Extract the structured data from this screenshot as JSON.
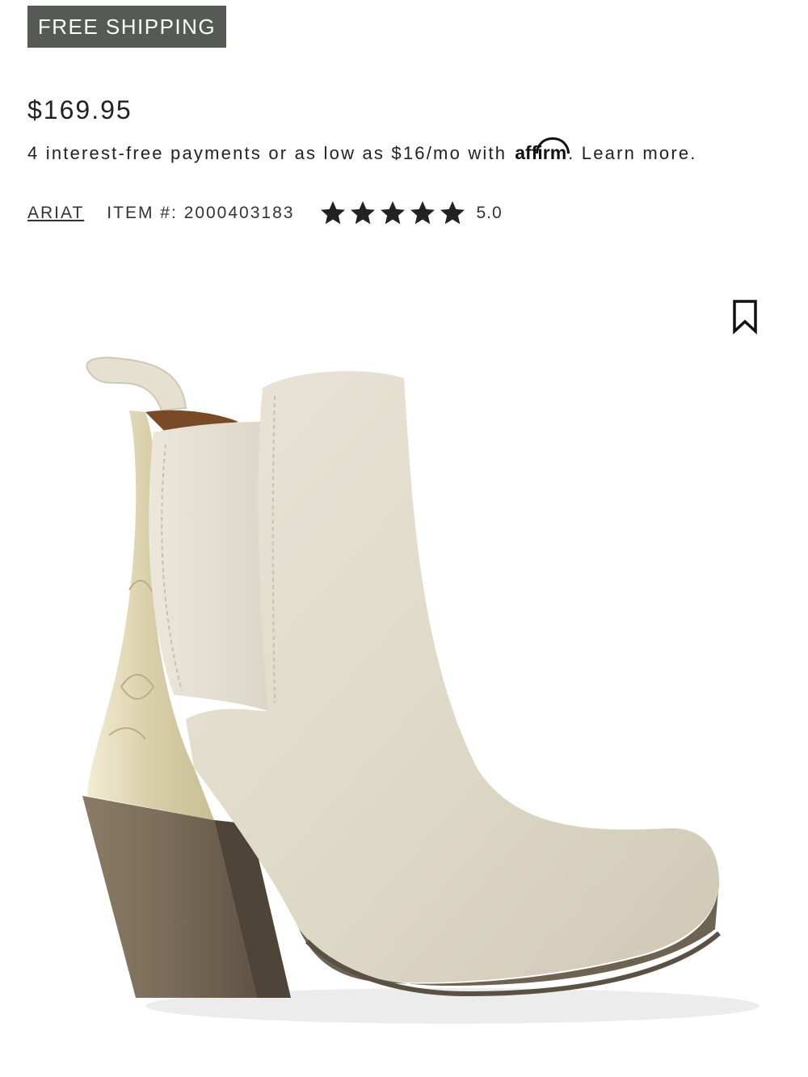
{
  "badge": {
    "label": "FREE SHIPPING"
  },
  "product": {
    "price": "$169.95",
    "payments_text": "4 interest-free payments or as low as $16/mo with",
    "affirm_logo_text": "affirm",
    "learn_more": ". Learn more.",
    "brand": "ARIAT",
    "item_number": "ITEM #: 2000403183",
    "rating": {
      "value": "5.0",
      "stars_filled": 5,
      "stars_total": 5
    }
  },
  "icons": {
    "star": "star-icon",
    "bookmark": "bookmark-icon"
  },
  "image": {
    "alt": "Cream suede western chelsea ankle boot with metallic embossed heel counter and stacked block heel"
  },
  "colors": {
    "badge_bg": "#555a55",
    "badge_text": "#ffffff",
    "text": "#222222",
    "star": "#222222"
  }
}
